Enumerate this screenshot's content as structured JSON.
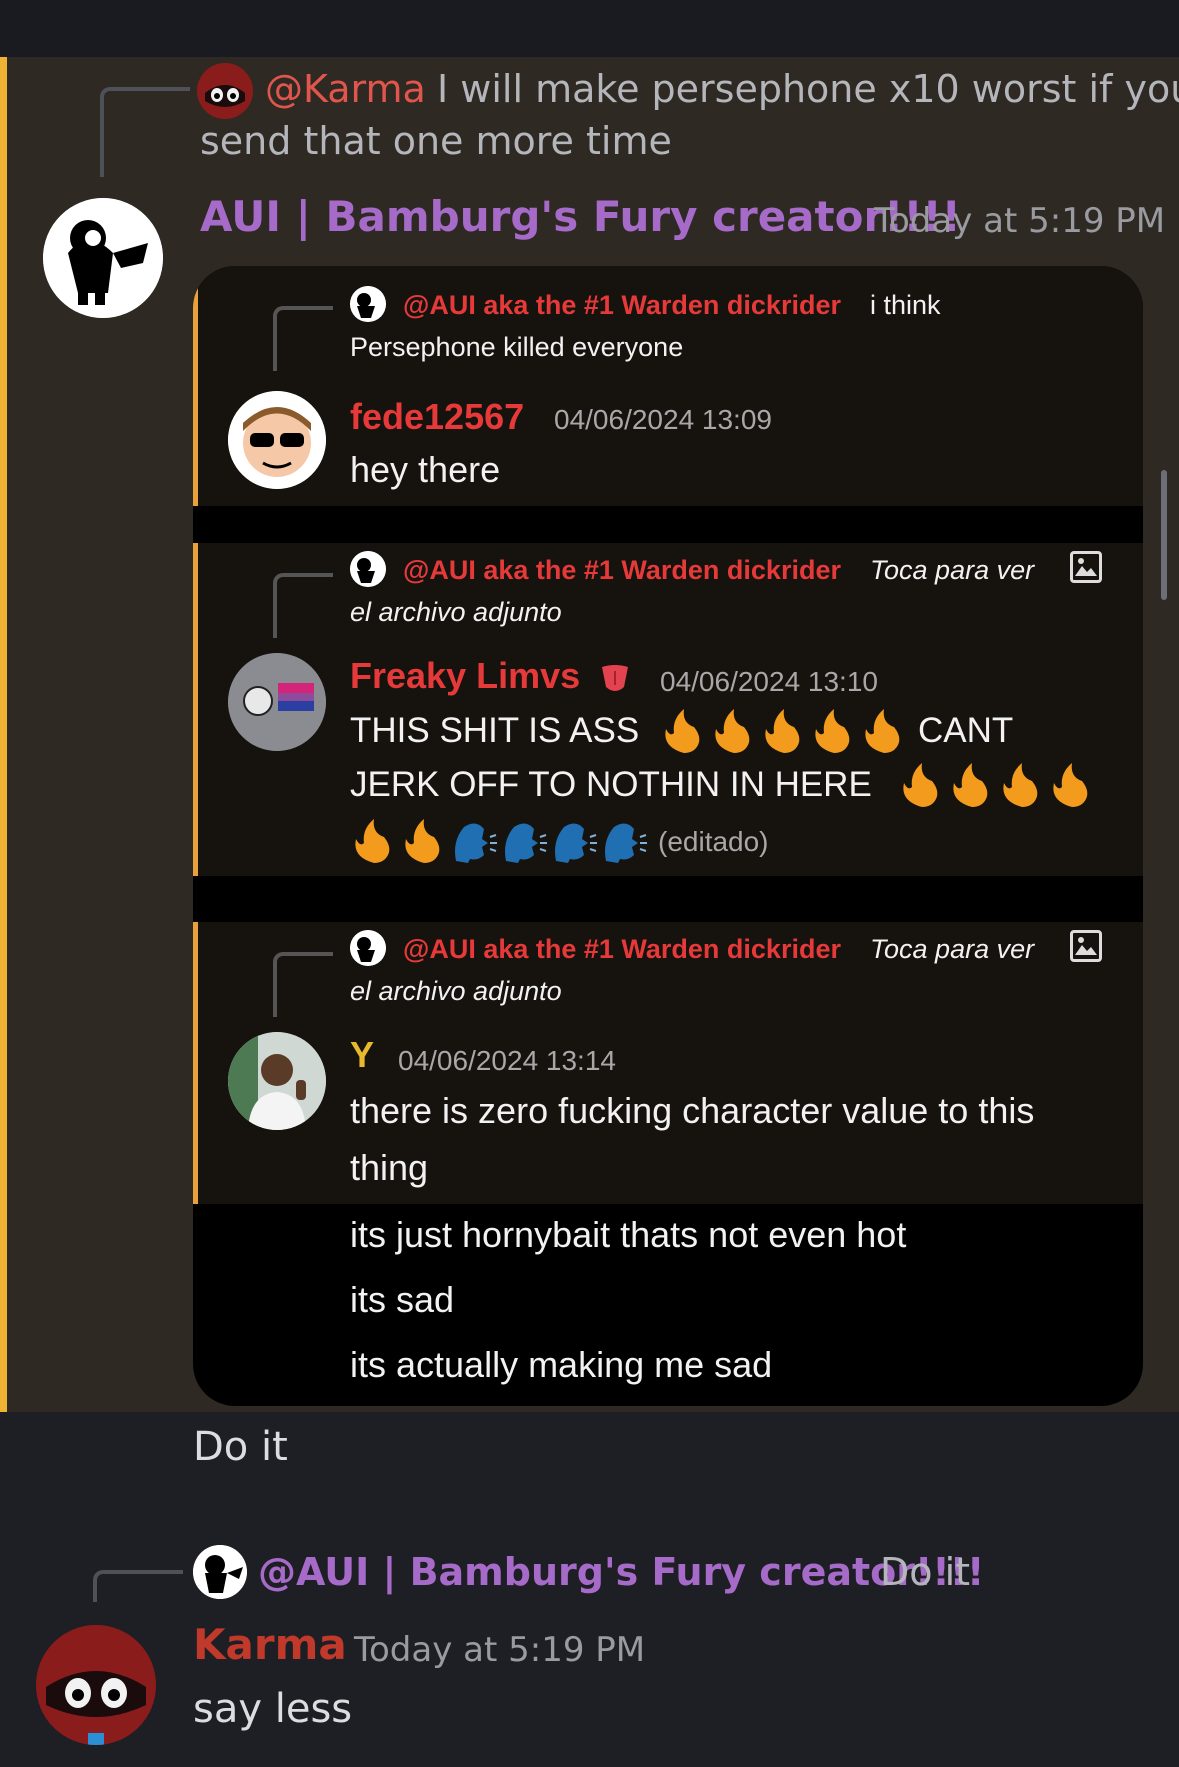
{
  "msg1": {
    "reply": {
      "mention": "@Karma",
      "text_line1": "I will make persephone x10 worst if you",
      "text_line2": "send that one more time"
    },
    "author": "AUI | Bamburg's Fury creator!!!!",
    "timestamp": "Today at 5:19 PM",
    "embed": {
      "q1": {
        "reply_mention": "@AUI aka the #1 Warden dickrider",
        "reply_text1": "i think",
        "reply_text2": "Persephone killed everyone",
        "author": "fede12567",
        "time": "04/06/2024 13:09",
        "body": "hey there"
      },
      "q2": {
        "reply_mention": "@AUI aka the #1 Warden dickrider",
        "reply_text1": "Toca para ver",
        "reply_text2": "el archivo adjunto",
        "author": "Freaky Limvs",
        "time": "04/06/2024 13:10",
        "line1": "THIS SHIT IS ASS",
        "line1b": "CANT",
        "line2": "JERK OFF TO NOTHIN IN HERE",
        "edited": "(editado)"
      },
      "q3": {
        "reply_mention": "@AUI aka the #1 Warden dickrider",
        "reply_text1": "Toca para ver",
        "reply_text2": "el archivo adjunto",
        "author": "Y",
        "time": "04/06/2024 13:14",
        "line1": "there is zero fucking character value to this",
        "line2": "thing"
      },
      "extra": [
        "its just hornybait thats not even hot",
        "its sad",
        "its actually making me sad"
      ]
    },
    "caption": "Do it"
  },
  "msg2": {
    "reply": {
      "mention": "@AUI | Bamburg's Fury creator!!!!",
      "text": "Do it"
    },
    "author": "Karma",
    "timestamp": "Today at 5:19 PM",
    "body": "say less"
  },
  "colors": {
    "mention_purple": "#a66ac9",
    "karma_red": "#c0392b",
    "embed_red": "#e63a3a",
    "highlight_gold": "#f0b232"
  }
}
